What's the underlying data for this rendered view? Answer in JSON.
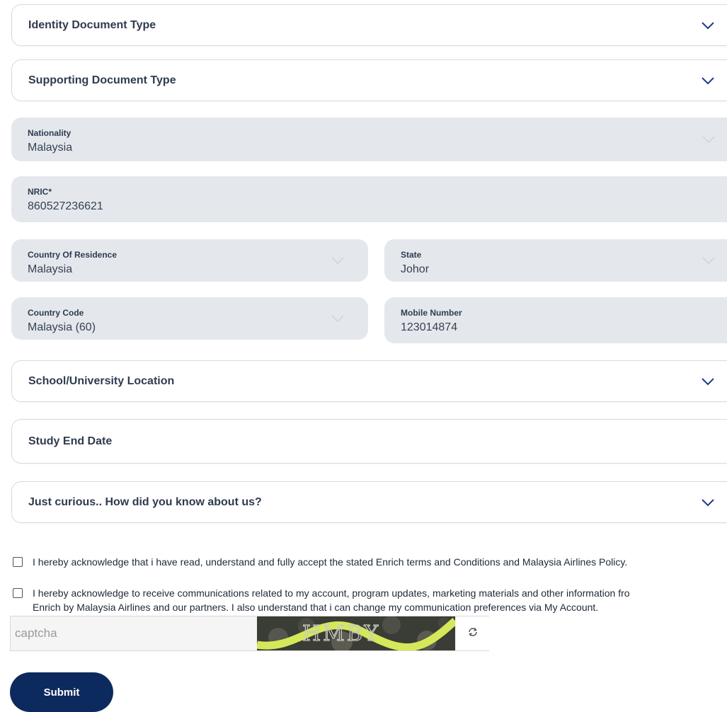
{
  "selects": {
    "identity_doc": "Identity Document Type",
    "supporting_doc": "Supporting Document Type",
    "school_location": "School/University Location",
    "study_end": "Study End Date",
    "curious": "Just curious.. How did you know about us?"
  },
  "fields": {
    "nationality": {
      "label": "Nationality",
      "value": "Malaysia"
    },
    "nric": {
      "label": "NRIC*",
      "value": "860527236621"
    },
    "country_residence": {
      "label": "Country Of Residence",
      "value": "Malaysia"
    },
    "state": {
      "label": "State",
      "value": "Johor"
    },
    "country_code": {
      "label": "Country Code",
      "value": "Malaysia (60)"
    },
    "mobile": {
      "label": "Mobile Number",
      "value": "123014874"
    }
  },
  "consents": {
    "terms": "I hereby acknowledge that i have read, understand and fully accept the stated Enrich terms and Conditions and Malaysia Airlines Policy.",
    "comms_line1": "I hereby acknowledge to receive communications related to my account, program updates, marketing materials and other information fro",
    "comms_line2": "Enrich by Malaysia Airlines and our partners. I also understand that i can change my communication preferences via My Account."
  },
  "captcha": {
    "placeholder": "captcha",
    "image_text": "HMBY"
  },
  "submit_label": "Submit",
  "icons": {
    "chevron": "chevron-down-icon",
    "refresh": "refresh-icon"
  },
  "colors": {
    "primary": "#0d2a5e",
    "chevron_active": "#1e3a8a",
    "chevron_muted": "#cfd5dd",
    "filled_bg": "#e4e8ed"
  }
}
